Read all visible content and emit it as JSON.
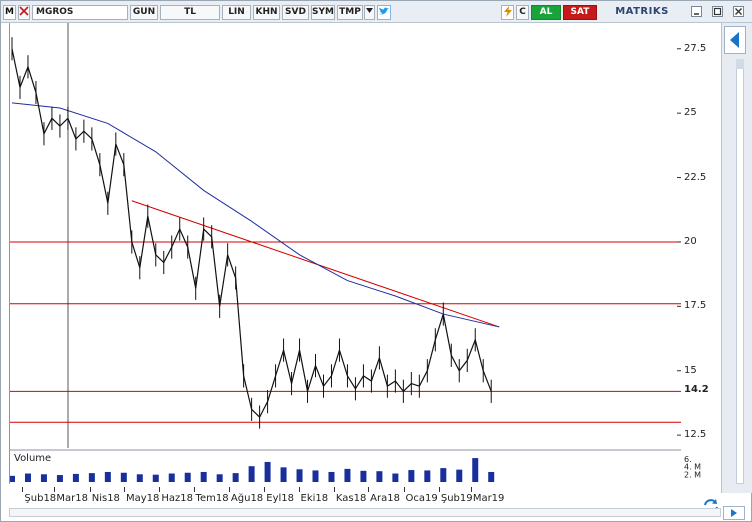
{
  "toolbar": {
    "logo": "M",
    "symbol": "MGROS",
    "buttons": [
      "GUN",
      "TL",
      "LIN",
      "KHN",
      "SVD",
      "SYM",
      "TMP"
    ],
    "buy_label": "AL",
    "sell_label": "SAT",
    "brand": "MATRIKS",
    "refresh_label": "C"
  },
  "colors": {
    "price": "#111111",
    "moving_average": "#1f2f9e",
    "levels": "#d40000",
    "volume": "#1a2f9e",
    "buy": "#1aa33a",
    "sell": "#c41a1a"
  },
  "chart_data": [
    {
      "type": "line",
      "name": "price",
      "x_categories": [
        "Şub18",
        "Mar18",
        "Nis18",
        "May18",
        "Haz18",
        "Tem18",
        "Ağu18",
        "Eyl18",
        "Eki18",
        "Kas18",
        "Ara18",
        "Oca19",
        "Şub19",
        "Mar19"
      ],
      "yticks": [
        12.5,
        15,
        17.5,
        20,
        22.5,
        25,
        27.5
      ],
      "ylim": [
        12.0,
        28.5
      ],
      "last_value_label": "14.2",
      "series": [
        {
          "x": [
            "2018-01-22",
            "2018-01-29",
            "2018-02-05",
            "2018-02-12",
            "2018-02-19",
            "2018-02-26",
            "2018-03-05",
            "2018-03-12",
            "2018-03-19",
            "2018-03-26",
            "2018-04-02",
            "2018-04-09",
            "2018-04-16",
            "2018-04-23",
            "2018-04-30",
            "2018-05-07",
            "2018-05-14",
            "2018-05-21",
            "2018-05-28",
            "2018-06-04",
            "2018-06-11",
            "2018-06-18",
            "2018-06-25",
            "2018-07-02",
            "2018-07-09",
            "2018-07-16",
            "2018-07-23",
            "2018-07-30",
            "2018-08-06",
            "2018-08-13",
            "2018-08-20",
            "2018-08-27",
            "2018-09-03",
            "2018-09-10",
            "2018-09-17",
            "2018-09-24",
            "2018-10-01",
            "2018-10-08",
            "2018-10-15",
            "2018-10-22",
            "2018-10-29",
            "2018-11-05",
            "2018-11-12",
            "2018-11-19",
            "2018-11-26",
            "2018-12-03",
            "2018-12-10",
            "2018-12-17",
            "2018-12-24",
            "2018-12-31",
            "2019-01-07",
            "2019-01-14",
            "2019-01-21",
            "2019-01-28",
            "2019-02-04",
            "2019-02-11",
            "2019-02-18",
            "2019-02-25",
            "2019-03-04",
            "2019-03-11",
            "2019-03-18"
          ],
          "values": [
            27.5,
            26.0,
            26.8,
            25.8,
            24.2,
            24.8,
            24.5,
            24.8,
            24.0,
            24.3,
            24.0,
            23.0,
            21.5,
            23.8,
            23.0,
            20.0,
            19.0,
            21.0,
            19.5,
            19.2,
            19.8,
            20.5,
            19.8,
            18.2,
            20.5,
            20.2,
            17.5,
            19.5,
            18.6,
            14.8,
            13.5,
            13.2,
            13.8,
            14.8,
            15.8,
            14.5,
            15.8,
            14.2,
            15.2,
            14.4,
            14.8,
            15.8,
            14.8,
            14.3,
            14.8,
            14.6,
            15.5,
            14.4,
            14.6,
            14.2,
            14.5,
            14.4,
            15.0,
            16.2,
            17.2,
            15.6,
            15.0,
            15.4,
            16.2,
            15.0,
            14.2
          ]
        },
        {
          "x": [
            "2018-01-22",
            "2018-03-05",
            "2018-04-16",
            "2018-05-28",
            "2018-07-09",
            "2018-08-20",
            "2018-10-01",
            "2018-11-12",
            "2018-12-24",
            "2019-02-04",
            "2019-03-25"
          ],
          "values": [
            25.4,
            25.2,
            24.6,
            23.5,
            22.0,
            20.8,
            19.5,
            18.5,
            17.9,
            17.2,
            16.7
          ]
        }
      ],
      "horizontal_lines": [
        20.0,
        17.6,
        14.2,
        13.0
      ],
      "trendline": {
        "x": [
          "2018-05-07",
          "2019-03-25"
        ],
        "values": [
          21.6,
          16.7
        ]
      }
    },
    {
      "type": "bar",
      "name": "volume",
      "legend": "Volume",
      "yticks": [
        "2. M",
        "4. M",
        "6."
      ],
      "x": [
        "2018-01-22",
        "2018-02-05",
        "2018-02-19",
        "2018-03-05",
        "2018-03-19",
        "2018-04-02",
        "2018-04-16",
        "2018-04-30",
        "2018-05-14",
        "2018-05-28",
        "2018-06-11",
        "2018-06-25",
        "2018-07-09",
        "2018-07-23",
        "2018-08-06",
        "2018-08-20",
        "2018-09-03",
        "2018-09-17",
        "2018-10-01",
        "2018-10-15",
        "2018-10-29",
        "2018-11-12",
        "2018-11-26",
        "2018-12-10",
        "2018-12-24",
        "2019-01-07",
        "2019-01-21",
        "2019-02-04",
        "2019-02-18",
        "2019-03-04",
        "2019-03-18"
      ],
      "values": [
        1.6,
        2.2,
        2.0,
        1.8,
        2.1,
        2.3,
        2.6,
        2.4,
        2.0,
        1.9,
        2.2,
        2.4,
        2.6,
        2.0,
        2.3,
        4.1,
        5.2,
        3.8,
        3.3,
        3.0,
        2.6,
        3.4,
        2.9,
        2.8,
        2.2,
        3.1,
        3.0,
        3.6,
        3.2,
        6.2,
        2.6
      ]
    }
  ]
}
